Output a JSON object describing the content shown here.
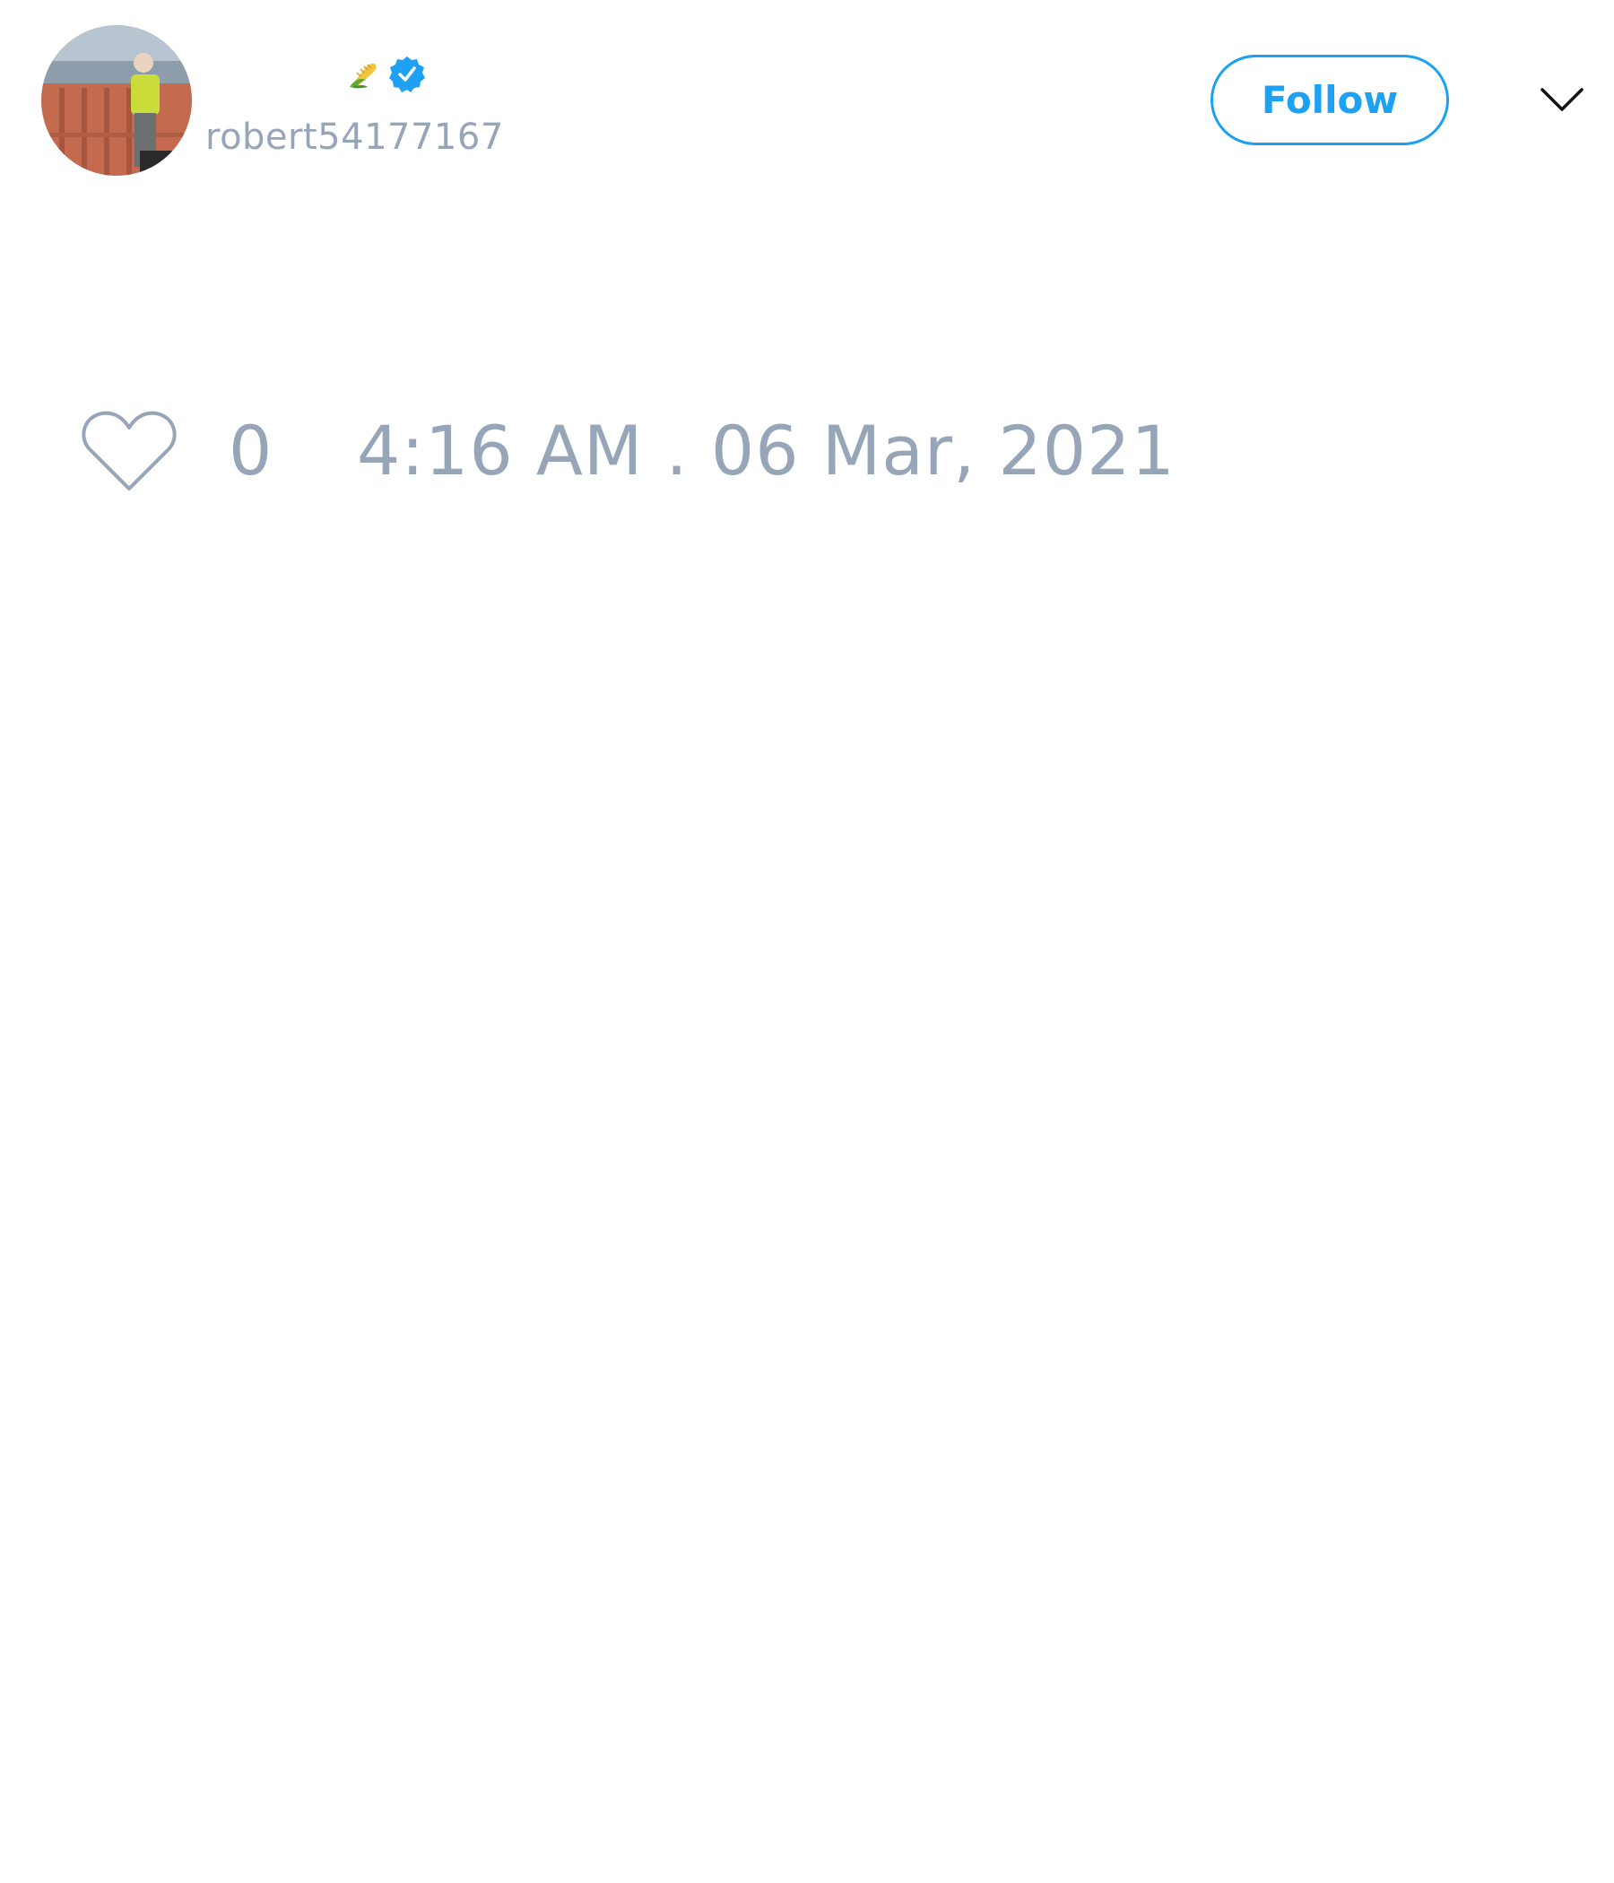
{
  "user": {
    "display_name": "🌽",
    "handle": "robert54177167",
    "verified": true,
    "avatar_icon": "avatar-photo-worker-on-wall",
    "verified_icon": "verified-badge-icon"
  },
  "actions": {
    "follow_label": "Follow",
    "more_icon": "chevron-down-icon"
  },
  "footer": {
    "like_icon": "heart-outline-icon",
    "like_count": "0",
    "timestamp": "4:16 AM . 06 Mar, 2021"
  },
  "colors": {
    "accent": "#1da1f2",
    "muted_text": "#97a5b8",
    "background": "#ffffff"
  }
}
